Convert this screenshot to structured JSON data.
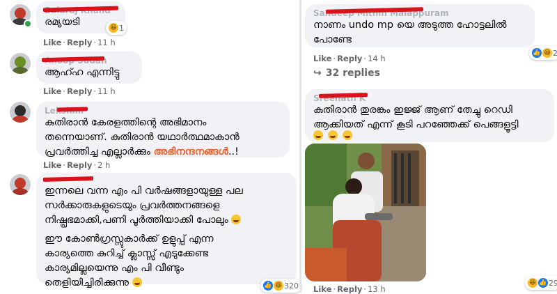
{
  "left_comments": [
    {
      "author": "Balaraj Khand",
      "text": "രമ്യയടി",
      "reaction_count": "1",
      "like": "Like",
      "reply": "Reply",
      "time": "11 h"
    },
    {
      "author": "Anoop Sudan",
      "text": "ആഹ്ഹ എന്നിട്ടു",
      "like": "Like",
      "reply": "Reply",
      "time": "11 h"
    },
    {
      "author": "Lekshmi",
      "text_main": "കുതിരാൻ കേരളത്തിന്റെ അഭിമാനം\nതന്നെയാണ്. കുതിരാൻ യഥാർത്ഥമാകാൻ\nപ്രവർത്തിച്ച എല്ലാർക്കും ",
      "text_highlight": "അഭിനന്ദനങ്ങൾ",
      "text_tail": "..!",
      "like": "Like",
      "reply": "Reply",
      "time": "2 h"
    },
    {
      "author": "",
      "para1": "ഇന്നലെ വന്ന എം പി വർഷങ്ങളായുള്ള പല\nസർക്കാരുകളുടെയും പ്രവർത്തനങ്ങളെ\nനിഷ്പ്രഭമാക്കി,പണി പൂർത്തിയാക്കി പോലും",
      "para2": "ഈ കോൺഗ്രസ്സുകാർക്ക് ഉളുപ്പ് എന്ന\nകാര്യത്തെ കുറിച്ച് ക്ലാസ്സ് എടുക്കേണ്ട\nകാര്യമില്ലയെന്നു എം പി വീണ്ടും\nതെളിയിച്ചിരിക്കുന്നു",
      "reaction_count": "320"
    }
  ],
  "right_comments": [
    {
      "author": "Sandeep Mithin Malappuram",
      "text": "നാണം undo mp യെ അടുത്ത ഹോട്ടലിൽ\nപോണ്ടേ",
      "like": "Like",
      "reply": "Reply",
      "time": "14 h",
      "replies": "32 replies",
      "reaction_count": "2"
    },
    {
      "author": "Sreenath K",
      "text": "കുതിരാൻ തുരങ്കം ഇജ്ജ് ആണ് തേച്ചു റെഡി\nആക്കിയത് എന്ന് കൂടി പറഞ്ഞേക്ക് പെങ്ങളൂട്ടി",
      "like": "Like",
      "reply": "Reply",
      "time": "13 h",
      "reaction_count": "29"
    }
  ],
  "colors": {
    "bubble": "#f0f2f5",
    "meta": "#65676b",
    "highlight": "#e95f2b",
    "redact": "#d8131b"
  }
}
